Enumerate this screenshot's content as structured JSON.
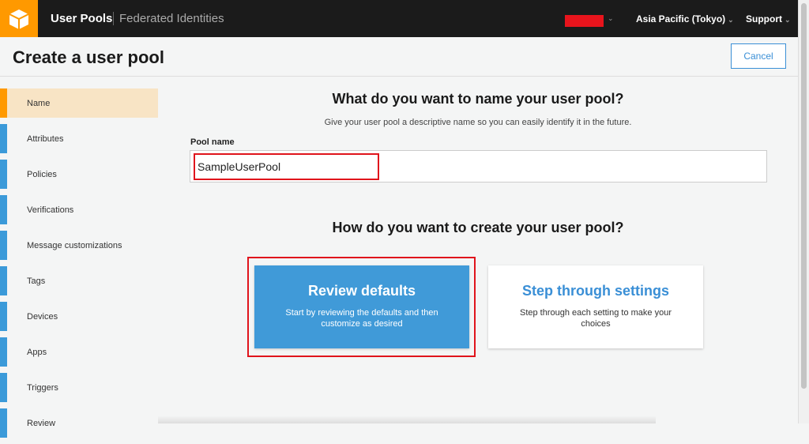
{
  "topbar": {
    "nav_user_pools": "User Pools",
    "nav_federated": "Federated Identities",
    "region": "Asia Pacific (Tokyo)",
    "support": "Support"
  },
  "page": {
    "title": "Create a user pool",
    "cancel": "Cancel"
  },
  "sidebar": {
    "items": [
      {
        "label": "Name"
      },
      {
        "label": "Attributes"
      },
      {
        "label": "Policies"
      },
      {
        "label": "Verifications"
      },
      {
        "label": "Message customizations"
      },
      {
        "label": "Tags"
      },
      {
        "label": "Devices"
      },
      {
        "label": "Apps"
      },
      {
        "label": "Triggers"
      },
      {
        "label": "Review"
      }
    ]
  },
  "main": {
    "name_heading": "What do you want to name your user pool?",
    "name_sub": "Give your user pool a descriptive name so you can easily identify it in the future.",
    "pool_label": "Pool name",
    "pool_value": "SampleUserPool",
    "create_heading": "How do you want to create your user pool?",
    "review": {
      "title": "Review defaults",
      "desc": "Start by reviewing the defaults and then customize as desired"
    },
    "step": {
      "title": "Step through settings",
      "desc": "Step through each setting to make your choices"
    }
  }
}
